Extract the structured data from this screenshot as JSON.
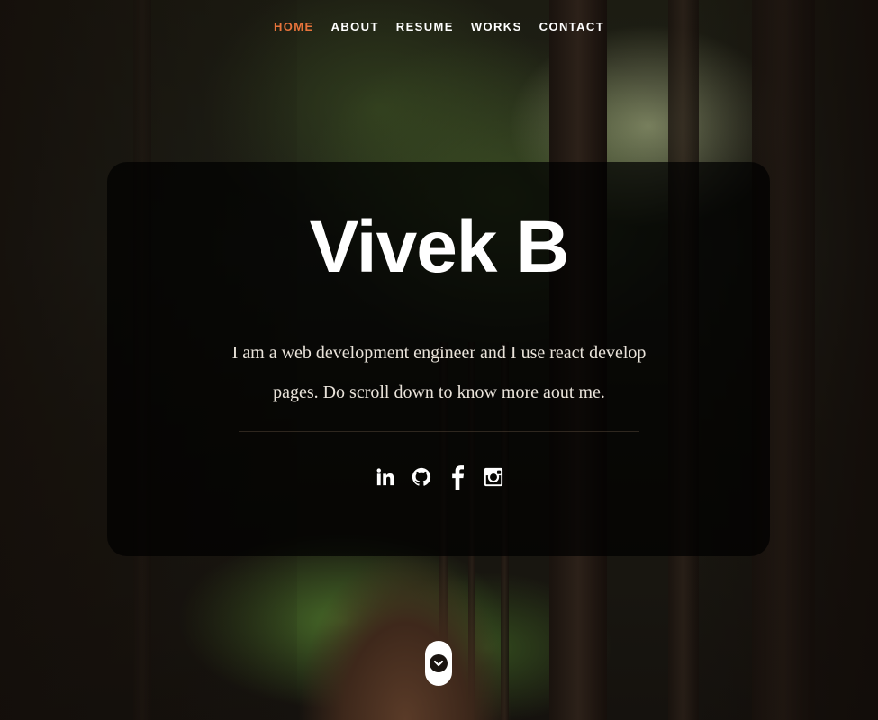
{
  "nav": {
    "items": [
      "HOME",
      "ABOUT",
      "RESUME",
      "WORKS",
      "CONTACT"
    ],
    "active": "HOME",
    "accent_color": "#e8743b"
  },
  "hero": {
    "name": "Vivek B",
    "bio": "I am a web development engineer and I use react develop pages. Do scroll down to know more aout me."
  },
  "social": {
    "icons": [
      "linkedin-icon",
      "github-icon",
      "facebook-icon",
      "instagram-icon"
    ]
  },
  "scroll_button": {
    "icon": "chevron-down-icon"
  }
}
